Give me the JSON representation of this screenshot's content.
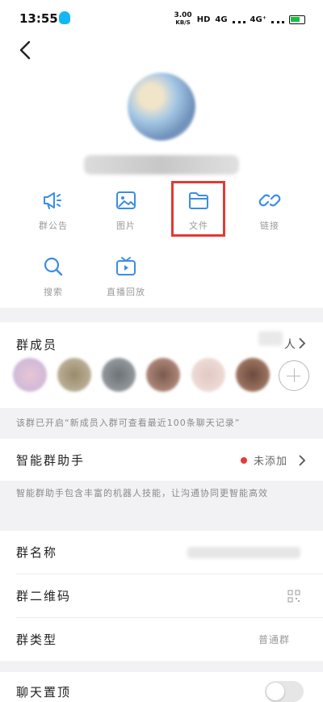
{
  "status_bar": {
    "time": "13:55",
    "speed_value": "3.00",
    "speed_unit": "KB/S",
    "hd_label": "HD",
    "net1": "4G",
    "net2": "4G⁺"
  },
  "features": [
    {
      "label": "群公告",
      "icon": "megaphone-icon"
    },
    {
      "label": "图片",
      "icon": "image-icon"
    },
    {
      "label": "文件",
      "icon": "folder-icon",
      "highlighted": true
    },
    {
      "label": "链接",
      "icon": "link-icon"
    },
    {
      "label": "搜索",
      "icon": "search-icon"
    },
    {
      "label": "直播回放",
      "icon": "tv-icon"
    }
  ],
  "members": {
    "title": "群成员",
    "count_suffix": "人",
    "note": "该群已开启“新成员入群可查看最近100条聊天记录”"
  },
  "assistant": {
    "title": "智能群助手",
    "status": "未添加",
    "status_color": "#e53935",
    "note": "智能群助手包含丰富的机器人技能，让沟通协同更智能高效"
  },
  "settings": {
    "group_name_label": "群名称",
    "qr_label": "群二维码",
    "type_label": "群类型",
    "type_value": "普通群",
    "pin_label": "聊天置顶"
  },
  "colors": {
    "accent": "#3a8ee6",
    "highlight_box": "#e53935"
  }
}
